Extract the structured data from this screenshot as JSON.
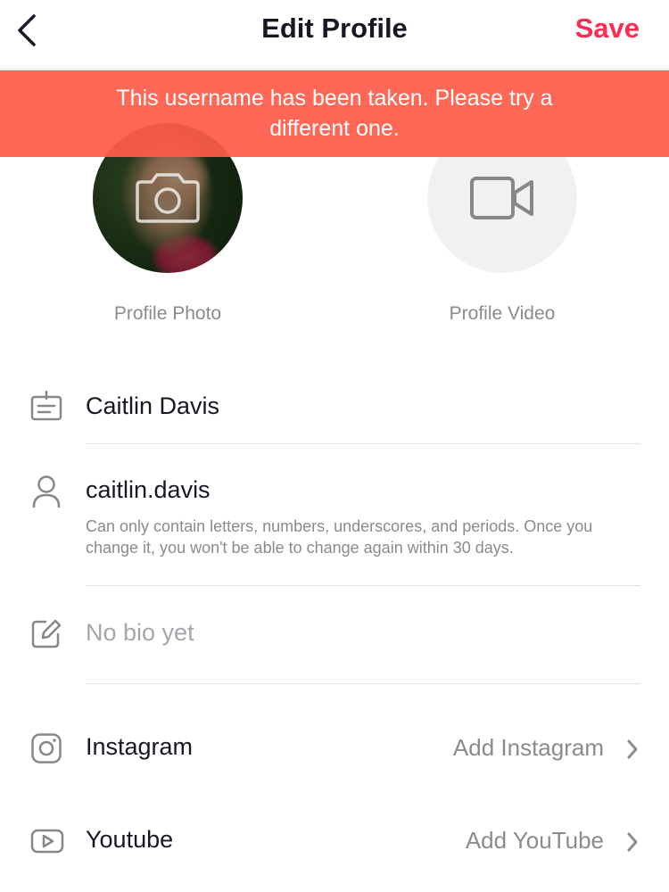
{
  "header": {
    "title": "Edit Profile",
    "save_label": "Save"
  },
  "banner": {
    "message": "This username has been taken. Please try a different one."
  },
  "avatars": {
    "photo_label": "Profile Photo",
    "video_label": "Profile Video"
  },
  "fields": {
    "name": "Caitlin Davis",
    "username": "caitlin.davis",
    "username_hint": "Can only contain letters, numbers, underscores, and periods. Once you change it, you won't be able to change again within 30 days.",
    "bio_placeholder": "No bio yet"
  },
  "links": {
    "instagram_label": "Instagram",
    "instagram_action": "Add Instagram",
    "youtube_label": "Youtube",
    "youtube_action": "Add YouTube"
  },
  "colors": {
    "accent": "#fe2c55",
    "banner": "#ff5c4a",
    "text": "#161823",
    "muted": "#8a8b91"
  },
  "icons": [
    "back-arrow-icon",
    "camera-icon",
    "video-camera-icon",
    "name-card-icon",
    "person-icon",
    "edit-icon",
    "instagram-icon",
    "youtube-icon",
    "chevron-right-icon"
  ]
}
